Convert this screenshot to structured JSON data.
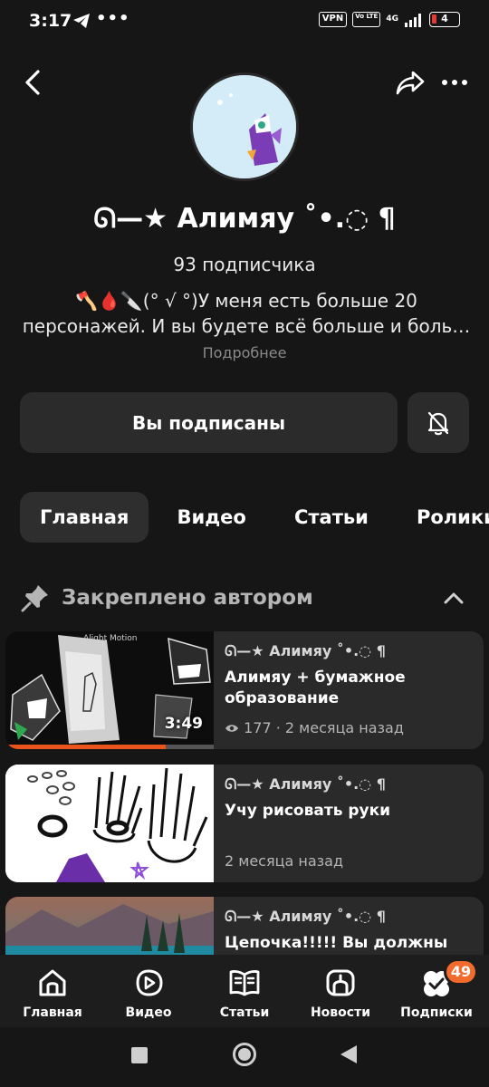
{
  "status_bar": {
    "time": "3:17",
    "dots": "•••",
    "vpn": "VPN",
    "volte": "Vo LTE",
    "network": "4G",
    "battery": "4"
  },
  "channel": {
    "name": "ᘏ—★ Алимяу ˚•.◌ ¶",
    "subscribers": "93 подписчика",
    "description": "🪓🩸🔪(° √ °)У меня есть больше 20 персонажей. И вы будете всё больше и боль…",
    "more_link": "Подробнее"
  },
  "actions": {
    "subscribe_label": "Вы подписаны"
  },
  "tabs": [
    {
      "label": "Главная",
      "active": true
    },
    {
      "label": "Видео",
      "active": false
    },
    {
      "label": "Статьи",
      "active": false
    },
    {
      "label": "Ролики",
      "active": false
    }
  ],
  "pinned_header": "Закреплено автором",
  "cards": [
    {
      "author": "ᘏ—★ Алимяу ˚•.◌ ¶",
      "title": "Алимяу + бумажное образование",
      "meta": "177 · 2 месяца назад",
      "duration": "3:49",
      "watermark": "Alight Motion",
      "progress": 0.77
    },
    {
      "author": "ᘏ—★ Алимяу ˚•.◌ ¶",
      "title": "Учу рисовать руки",
      "meta": "2 месяца назад"
    },
    {
      "author": "ᘏ—★ Алимяу ˚•.◌ ¶",
      "title": "Цепочка!!!!! Вы должны"
    }
  ],
  "bottom_nav": [
    {
      "label": "Главная",
      "icon": "home-icon"
    },
    {
      "label": "Видео",
      "icon": "video-icon"
    },
    {
      "label": "Статьи",
      "icon": "articles-icon"
    },
    {
      "label": "Новости",
      "icon": "news-icon"
    },
    {
      "label": "Подписки",
      "icon": "subscriptions-icon",
      "badge": "49"
    }
  ],
  "colors": {
    "background": "#161616",
    "surface": "#2b2b2b",
    "accent": "#f26b2c",
    "muted_text": "#8a8a8a"
  }
}
